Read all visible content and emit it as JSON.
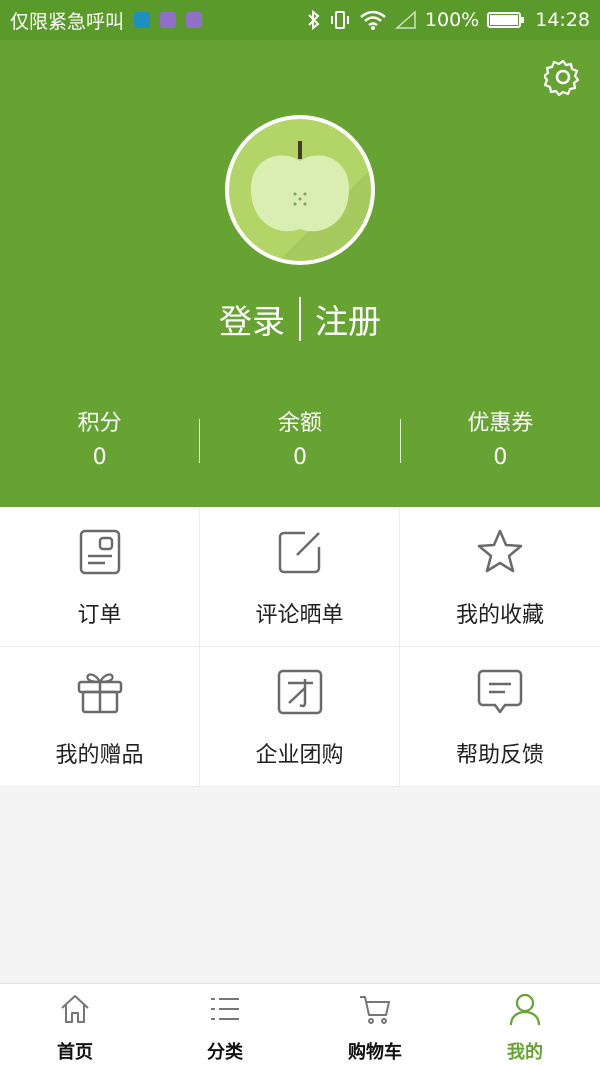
{
  "status_bar": {
    "carrier": "仅限紧急呼叫",
    "battery": "100%",
    "time": "14:28"
  },
  "header": {
    "login_label": "登录",
    "register_label": "注册",
    "stats": [
      {
        "label": "积分",
        "value": "0"
      },
      {
        "label": "余额",
        "value": "0"
      },
      {
        "label": "优惠券",
        "value": "0"
      }
    ]
  },
  "menu": {
    "items": [
      {
        "label": "订单",
        "icon": "order-icon"
      },
      {
        "label": "评论晒单",
        "icon": "comment-icon"
      },
      {
        "label": "我的收藏",
        "icon": "star-icon"
      },
      {
        "label": "我的赠品",
        "icon": "gift-icon"
      },
      {
        "label": "企业团购",
        "icon": "group-buy-icon"
      },
      {
        "label": "帮助反馈",
        "icon": "feedback-icon"
      }
    ]
  },
  "bottom_nav": {
    "items": [
      {
        "label": "首页",
        "icon": "home-icon"
      },
      {
        "label": "分类",
        "icon": "list-icon"
      },
      {
        "label": "购物车",
        "icon": "cart-icon"
      },
      {
        "label": "我的",
        "icon": "user-icon"
      }
    ],
    "active_index": 3
  },
  "colors": {
    "brand": "#66a333",
    "status_bar": "#5a9a2a",
    "icon_gray": "#6a6a6a"
  }
}
